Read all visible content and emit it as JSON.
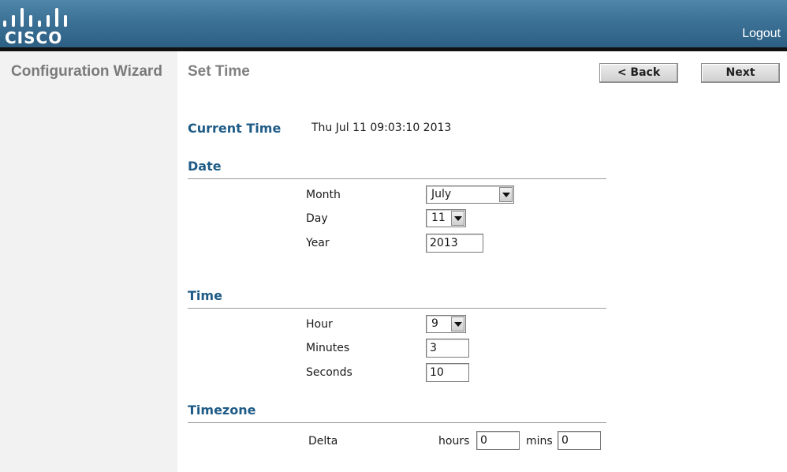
{
  "header": {
    "brand": "CISCO",
    "logout_label": "Logout"
  },
  "sidebar": {
    "title": "Configuration Wizard"
  },
  "main": {
    "page_title": "Set Time",
    "back_label": "< Back",
    "next_label": "Next",
    "current_time": {
      "label": "Current Time",
      "value": "Thu Jul 11 09:03:10 2013"
    },
    "date": {
      "heading": "Date",
      "month": {
        "label": "Month",
        "value": "July"
      },
      "day": {
        "label": "Day",
        "value": "11"
      },
      "year": {
        "label": "Year",
        "value": "2013"
      }
    },
    "time": {
      "heading": "Time",
      "hour": {
        "label": "Hour",
        "value": "9"
      },
      "minutes": {
        "label": "Minutes",
        "value": "3"
      },
      "seconds": {
        "label": "Seconds",
        "value": "10"
      }
    },
    "timezone": {
      "heading": "Timezone",
      "delta_label": "Delta",
      "hours_label": "hours",
      "hours_value": "0",
      "mins_label": "mins",
      "mins_value": "0"
    }
  },
  "colors": {
    "header_blue": "#3c7196",
    "heading_blue": "#1e5b86",
    "sidebar_gray": "#f2f2f2"
  },
  "icons": [
    "cisco-logo-icon",
    "dropdown-arrow-icon"
  ]
}
